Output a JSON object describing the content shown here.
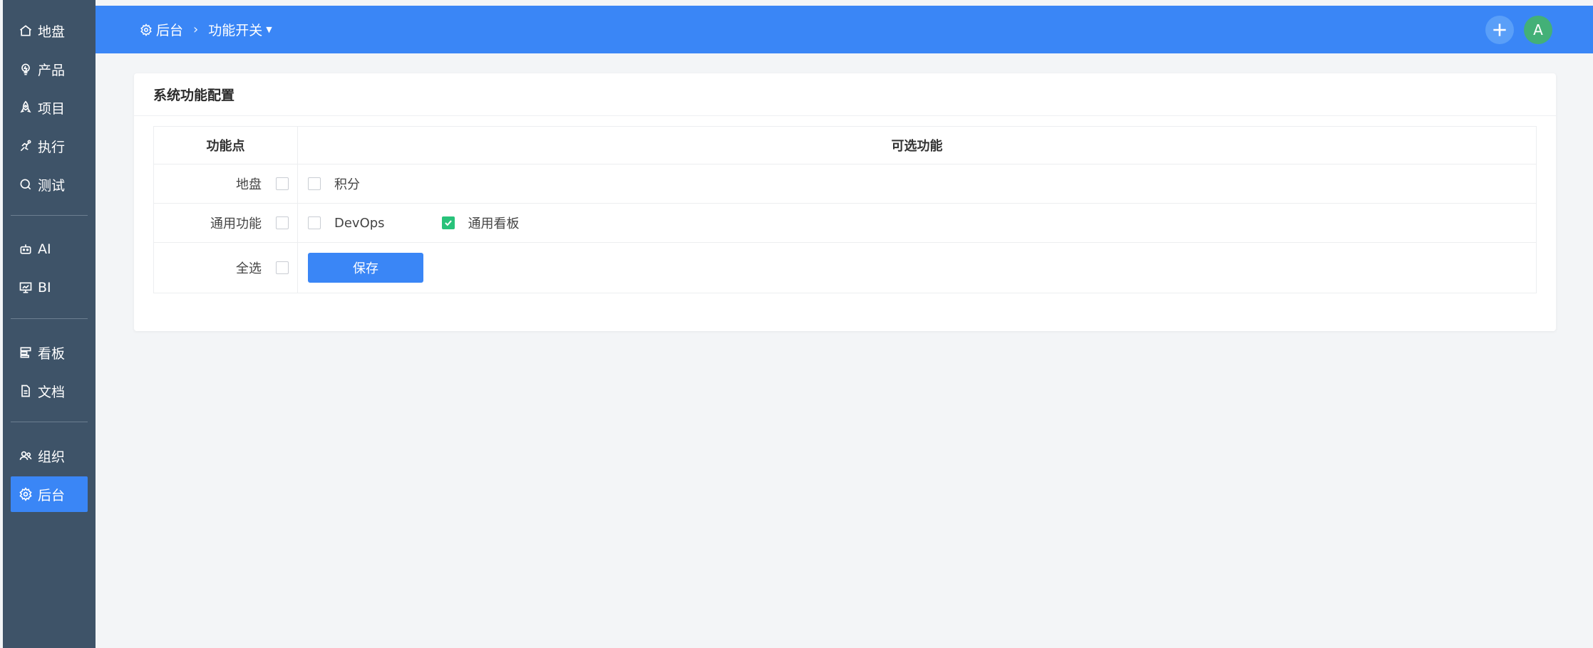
{
  "sidebar": {
    "items": [
      {
        "label": "地盘",
        "icon": "home-icon"
      },
      {
        "label": "产品",
        "icon": "lightbulb-icon"
      },
      {
        "label": "项目",
        "icon": "rocket-icon"
      },
      {
        "label": "执行",
        "icon": "run-icon"
      },
      {
        "label": "测试",
        "icon": "search-icon"
      },
      {
        "label": "AI",
        "icon": "robot-icon"
      },
      {
        "label": "BI",
        "icon": "chart-board-icon"
      },
      {
        "label": "看板",
        "icon": "kanban-icon"
      },
      {
        "label": "文档",
        "icon": "document-icon"
      },
      {
        "label": "组织",
        "icon": "users-icon"
      },
      {
        "label": "后台",
        "icon": "gear-icon"
      }
    ],
    "active": "后台"
  },
  "header": {
    "breadcrumb_root": "后台",
    "breadcrumb_current": "功能开关",
    "avatar_letter": "A",
    "accent": "#3a86f6"
  },
  "card": {
    "title": "系统功能配置",
    "table": {
      "col_feature": "功能点",
      "col_options": "可选功能",
      "rows": [
        {
          "label": "地盘",
          "checked": false,
          "options": [
            {
              "label": "积分",
              "checked": false
            }
          ]
        },
        {
          "label": "通用功能",
          "checked": false,
          "options": [
            {
              "label": "DevOps",
              "checked": false
            },
            {
              "label": "通用看板",
              "checked": true
            }
          ]
        }
      ],
      "select_all_label": "全选",
      "select_all_checked": false
    },
    "save_label": "保存"
  }
}
